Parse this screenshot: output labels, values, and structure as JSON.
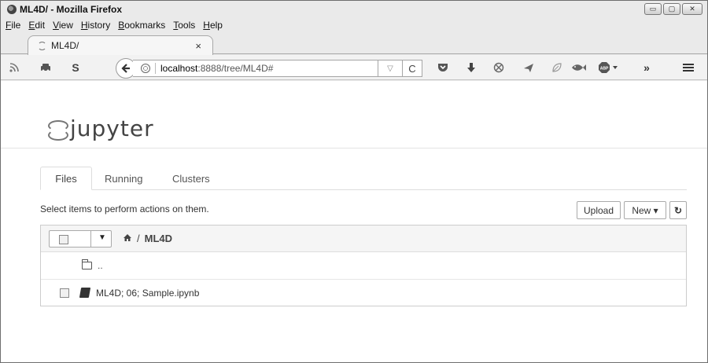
{
  "window": {
    "title": "ML4D/ - Mozilla Firefox",
    "controls": {
      "minimize": "▭",
      "maximize": "▢",
      "close": "✕"
    }
  },
  "menubar": [
    "File",
    "Edit",
    "View",
    "History",
    "Bookmarks",
    "Tools",
    "Help"
  ],
  "tab": {
    "label": "ML4D/",
    "close": "×"
  },
  "navbar": {
    "url_host": "localhost",
    "url_path": ":8888/tree/ML4D#",
    "dropdown": "▽",
    "reload": "C",
    "icons": [
      "rss-icon",
      "car-icon",
      "s-icon",
      "pocket-icon",
      "download-icon",
      "blocked-icon",
      "send-icon",
      "leaf-icon",
      "fish-icon",
      "adblock-icon",
      "overflow-icon",
      "hamburger-menu-icon"
    ]
  },
  "jupyter": {
    "logo_text": "jupyter",
    "tabs": [
      "Files",
      "Running",
      "Clusters"
    ],
    "select_text": "Select items to perform actions on them.",
    "buttons": {
      "upload": "Upload",
      "new": "New ▾",
      "refresh": "↻"
    },
    "breadcrumb": {
      "separator": "/",
      "dir": "ML4D"
    },
    "rows": [
      {
        "label": "..",
        "type": "folder"
      },
      {
        "label": "ML4D; 06; Sample.ipynb",
        "type": "notebook"
      }
    ]
  }
}
